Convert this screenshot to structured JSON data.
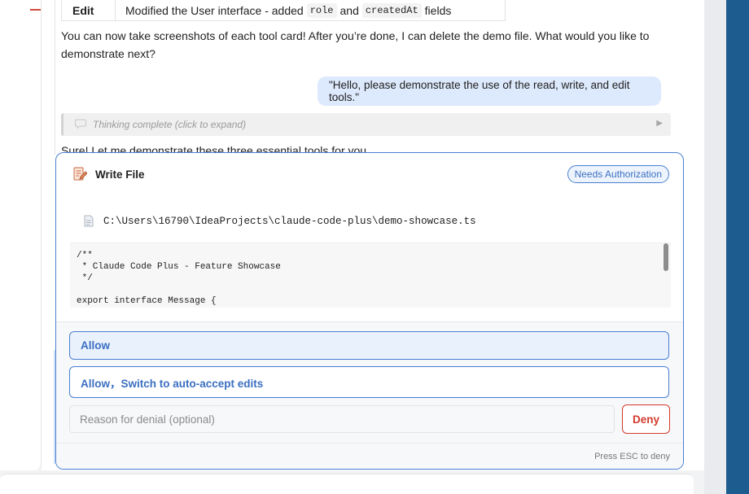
{
  "edit_row": {
    "tool": "Edit",
    "desc_prefix": "Modified the User interface - added",
    "code1": "role",
    "conj": "and",
    "code2": "createdAt",
    "desc_suffix": "fields"
  },
  "assistant_paragraph": "You can now take screenshots of each tool card! After you’re done, I can delete the demo file. What would you like to demonstrate next?",
  "user_message": "\"Hello, please demonstrate the use of the read, write, and edit tools.\"",
  "thinking": {
    "label": "Thinking complete (click to expand)",
    "icon": "speech-bubble-icon",
    "expand_icon": "play-triangle-icon"
  },
  "assistant_intro": "Sure! Let me demonstrate these three essential tools for you.",
  "tool_card": {
    "icon": "write-file-icon",
    "title": "Write File",
    "badge": "Needs Authorization",
    "file_path": "C:\\Users\\16790\\IdeaProjects\\claude-code-plus\\demo-showcase.ts",
    "code": "/**\n * Claude Code Plus - Feature Showcase\n */\n\nexport interface Message {",
    "allow_label": "Allow",
    "allow_auto_label": "Allow，Switch to auto-accept edits",
    "deny_placeholder": "Reason for denial (optional)",
    "deny_label": "Deny",
    "esc_hint": "Press ESC to deny"
  },
  "colors": {
    "accent": "#4a7fd1",
    "deny": "#d33a2c",
    "user_bubble": "#dde9fc"
  }
}
